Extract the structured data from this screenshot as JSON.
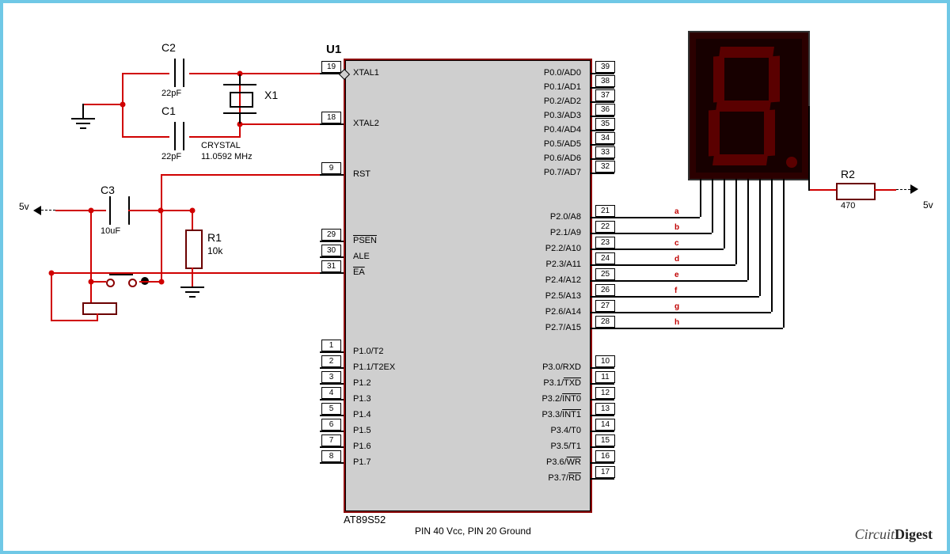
{
  "ic": {
    "ref": "U1",
    "part": "AT89S52",
    "note": "PIN 40 Vcc, PIN 20 Ground",
    "left_pins": [
      {
        "num": "19",
        "name": "XTAL1"
      },
      {
        "num": "18",
        "name": "XTAL2"
      },
      {
        "num": "9",
        "name": "RST"
      },
      {
        "num": "29",
        "name": "PSEN",
        "over": true
      },
      {
        "num": "30",
        "name": "ALE"
      },
      {
        "num": "31",
        "name": "EA",
        "over": true
      },
      {
        "num": "1",
        "name": "P1.0/T2"
      },
      {
        "num": "2",
        "name": "P1.1/T2EX"
      },
      {
        "num": "3",
        "name": "P1.2"
      },
      {
        "num": "4",
        "name": "P1.3"
      },
      {
        "num": "5",
        "name": "P1.4"
      },
      {
        "num": "6",
        "name": "P1.5"
      },
      {
        "num": "7",
        "name": "P1.6"
      },
      {
        "num": "8",
        "name": "P1.7"
      }
    ],
    "right_pins": [
      {
        "num": "39",
        "name": "P0.0/AD0"
      },
      {
        "num": "38",
        "name": "P0.1/AD1"
      },
      {
        "num": "37",
        "name": "P0.2/AD2"
      },
      {
        "num": "36",
        "name": "P0.3/AD3"
      },
      {
        "num": "35",
        "name": "P0.4/AD4"
      },
      {
        "num": "34",
        "name": "P0.5/AD5"
      },
      {
        "num": "33",
        "name": "P0.6/AD6"
      },
      {
        "num": "32",
        "name": "P0.7/AD7"
      },
      {
        "num": "21",
        "name": "P2.0/A8"
      },
      {
        "num": "22",
        "name": "P2.1/A9"
      },
      {
        "num": "23",
        "name": "P2.2/A10"
      },
      {
        "num": "24",
        "name": "P2.3/A11"
      },
      {
        "num": "25",
        "name": "P2.4/A12"
      },
      {
        "num": "26",
        "name": "P2.5/A13"
      },
      {
        "num": "27",
        "name": "P2.6/A14"
      },
      {
        "num": "28",
        "name": "P2.7/A15"
      },
      {
        "num": "10",
        "name": "P3.0/RXD"
      },
      {
        "num": "11",
        "name": "P3.1/TXD",
        "over": "TXD"
      },
      {
        "num": "12",
        "name": "P3.2/INT0",
        "over": "INT0"
      },
      {
        "num": "13",
        "name": "P3.3/INT1",
        "over": "INT1"
      },
      {
        "num": "14",
        "name": "P3.4/T0"
      },
      {
        "num": "15",
        "name": "P3.5/T1"
      },
      {
        "num": "16",
        "name": "P3.6/WR",
        "over": "WR"
      },
      {
        "num": "17",
        "name": "P3.7/RD",
        "over": "RD"
      }
    ]
  },
  "components": {
    "C2": {
      "ref": "C2",
      "val": "22pF"
    },
    "C1": {
      "ref": "C1",
      "val": "22pF"
    },
    "C3": {
      "ref": "C3",
      "val": "10uF"
    },
    "R1": {
      "ref": "R1",
      "val": "10k"
    },
    "R2": {
      "ref": "R2",
      "val": "470"
    },
    "X1": {
      "ref": "X1",
      "val": "CRYSTAL",
      "freq": "11.0592 MHz"
    }
  },
  "power": {
    "five_v": "5v"
  },
  "seg_labels": [
    "a",
    "b",
    "c",
    "d",
    "e",
    "f",
    "g",
    "h"
  ],
  "watermark": "CircuitDigest"
}
